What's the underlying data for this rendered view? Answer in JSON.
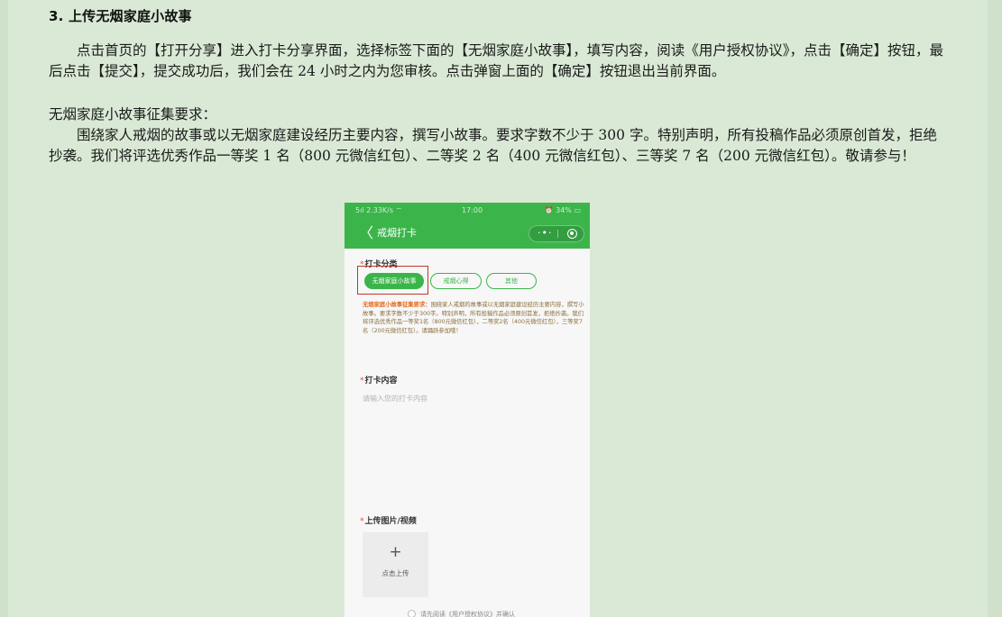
{
  "doc": {
    "heading": "3. 上传无烟家庭小故事",
    "paragraph1": "点击首页的【打开分享】进入打卡分享界面，选择标签下面的【无烟家庭小故事】，填写内容，阅读《用户授权协议》，点击【确定】按钮，最后点击【提交】，提交成功后，我们会在 24 小时之内为您审核。点击弹窗上面的【确定】按钮退出当前界面。",
    "requirements_title": "无烟家庭小故事征集要求：",
    "paragraph2": "围绕家人戒烟的故事或以无烟家庭建设经历主要内容，撰写小故事。要求字数不少于 300 字。特别声明，所有投稿作品必须原创首发，拒绝抄袭。我们将评选优秀作品一等奖 1 名（800 元微信红包）、二等奖 2 名（400 元微信红包）、三等奖 7 名（200 元微信红包）。敬请参与！"
  },
  "phone": {
    "status": {
      "left": "5ıl 2.33K/s ⌔",
      "time": "17:00",
      "right": "⏰ 34% ▭"
    },
    "nav": {
      "back_glyph": "〈",
      "title": "戒烟打卡",
      "more_glyph": "·•·"
    },
    "required_mark": "*",
    "category_label": "打卡分类",
    "tabs": [
      {
        "label": "无烟家庭小故事",
        "active": true
      },
      {
        "label": "戒烟心得",
        "active": false
      },
      {
        "label": "其他",
        "active": false
      }
    ],
    "guide": {
      "title": "无烟家庭小故事征集要求：",
      "text": "围绕家人戒烟的故事或以无烟家庭建设经历主要内容，撰写小故事。要求字数不少于300字。特别声明，所有投稿作品必须原创首发，拒绝抄袭。我们将评选优秀作品一等奖1名（800元微信红包），二等奖2名（400元微信红包），三等奖7名（200元微信红包）。请踊跃参加哦！"
    },
    "content_label": "打卡内容",
    "content_placeholder": "请输入您的打卡内容",
    "upload_label": "上传图片/视频",
    "upload_plus": "+",
    "upload_text": "点击上传",
    "agree_text": "请先阅读《用户授权协议》并确认"
  },
  "colors": {
    "page_bg": "#d9e9d5",
    "wechat_green": "#3bb54a",
    "highlight_red": "#c0392b",
    "guide_orange": "#e36b1e"
  }
}
